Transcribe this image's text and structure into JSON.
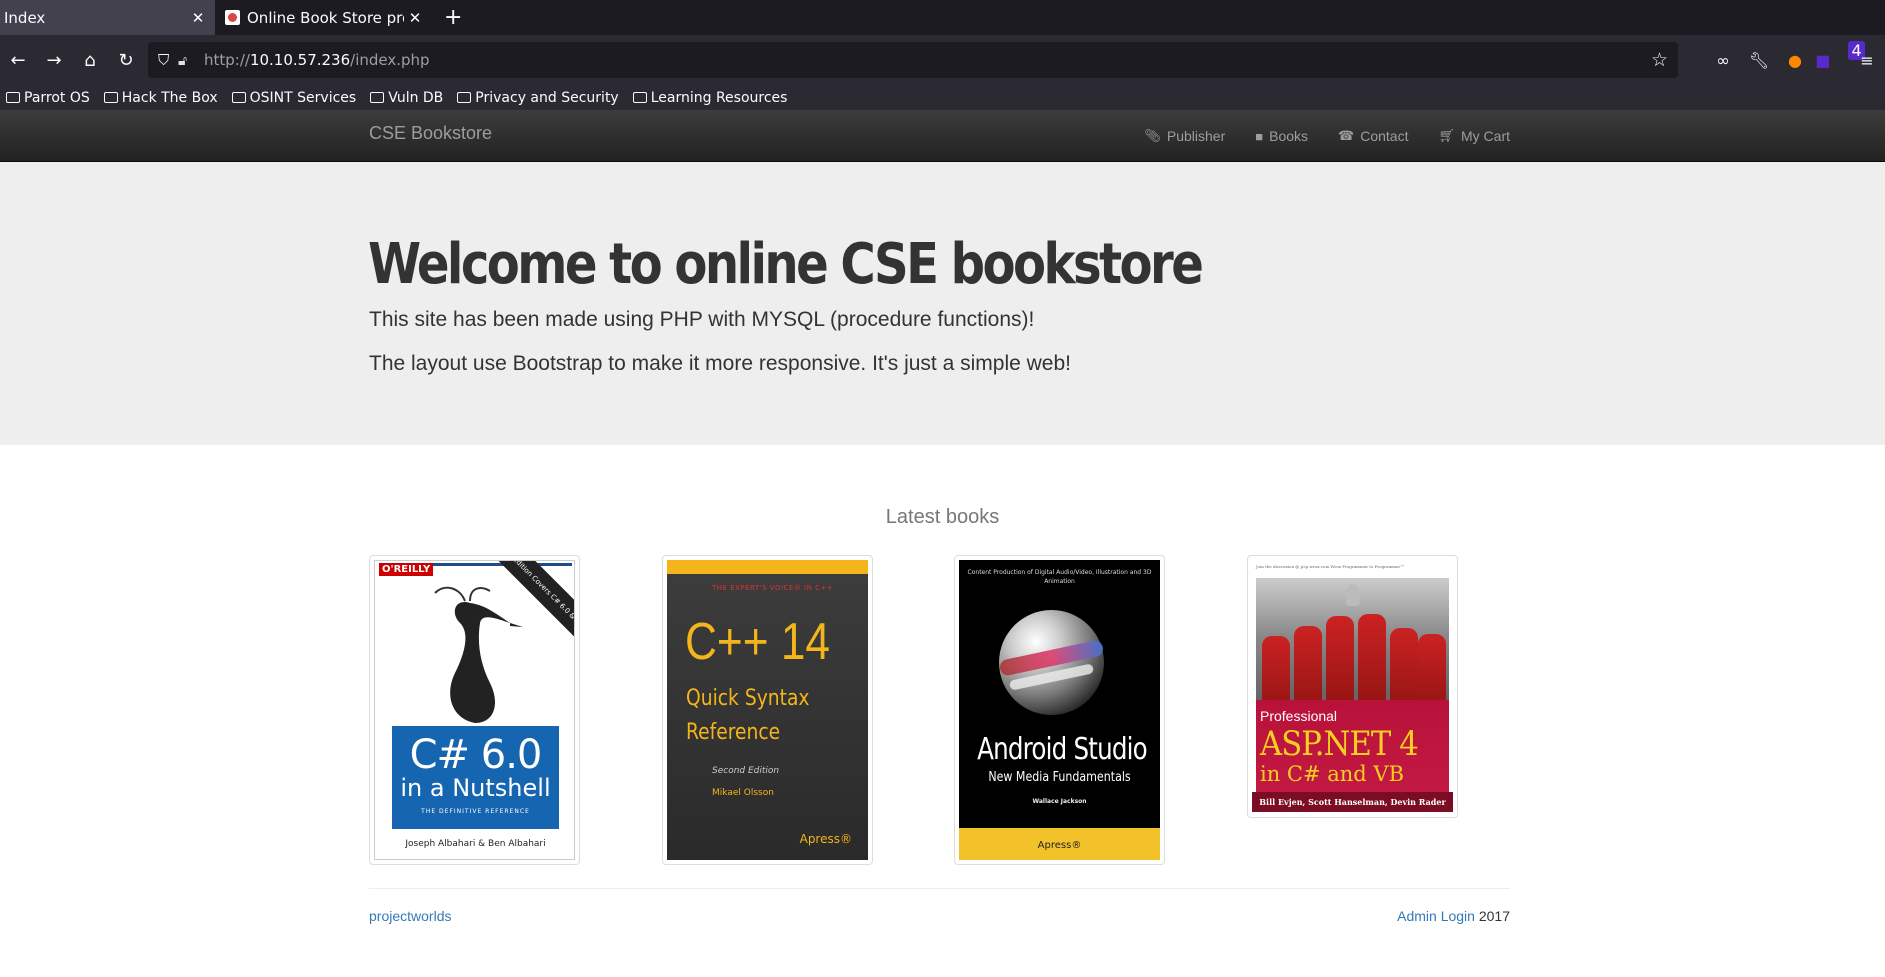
{
  "browser": {
    "tabs": [
      {
        "title": "Index",
        "active": false
      },
      {
        "title": "Online Book Store project",
        "active": true
      }
    ],
    "url_prefix": "http://",
    "url_host": "10.10.57.236",
    "url_path": "/index.php",
    "extension_badge": "4",
    "bookmarks": [
      "Parrot OS",
      "Hack The Box",
      "OSINT Services",
      "Vuln DB",
      "Privacy and Security",
      "Learning Resources"
    ]
  },
  "site": {
    "brand": "CSE Bookstore",
    "nav": [
      {
        "label": "Publisher",
        "icon": "paperclip-icon"
      },
      {
        "label": "Books",
        "icon": "book-icon"
      },
      {
        "label": "Contact",
        "icon": "phone-icon"
      },
      {
        "label": "My Cart",
        "icon": "cart-icon"
      }
    ],
    "jumbotron": {
      "heading": "Welcome to online CSE bookstore",
      "line1": "This site has been made using PHP with MYSQL (procedure functions)!",
      "line2": "The layout use Bootstrap to make it more responsive. It's just a simple web!"
    },
    "latest_heading": "Latest books",
    "books": [
      {
        "publisher_tag": "O'REILLY",
        "edition_badge": "6th Edition Covers C# 6.0 & the Roslyn Compiler",
        "title_1": "C# 6.0",
        "title_2": "in a Nutshell",
        "subtitle": "THE DEFINITIVE REFERENCE",
        "authors": "Joseph Albahari & Ben Albahari"
      },
      {
        "series": "THE EXPERT'S VOICE® IN C++",
        "title_1": "C++ 14",
        "title_2": "Quick Syntax",
        "title_3": "Reference",
        "edition": "Second Edition",
        "authors": "Mikael Olsson",
        "publisher": "Apress®"
      },
      {
        "top": "Content Production of Digital Audio/Video, Illustration and 3D Animation",
        "title_1": "Android Studio",
        "title_2": "New Media Fundamentals",
        "authors": "Wallace Jackson",
        "publisher": "Apress®"
      },
      {
        "header": "Join the discussion @ p2p.wrox.com        Wrox Programmer to Programmer™",
        "label": "Professional",
        "title_1": "ASP.NET 4",
        "title_2": "in C# and VB",
        "authors": "Bill Evjen, Scott Hanselman, Devin Rader"
      }
    ],
    "footer": {
      "left": "projectworlds",
      "admin_link": "Admin Login",
      "year": "2017"
    }
  }
}
